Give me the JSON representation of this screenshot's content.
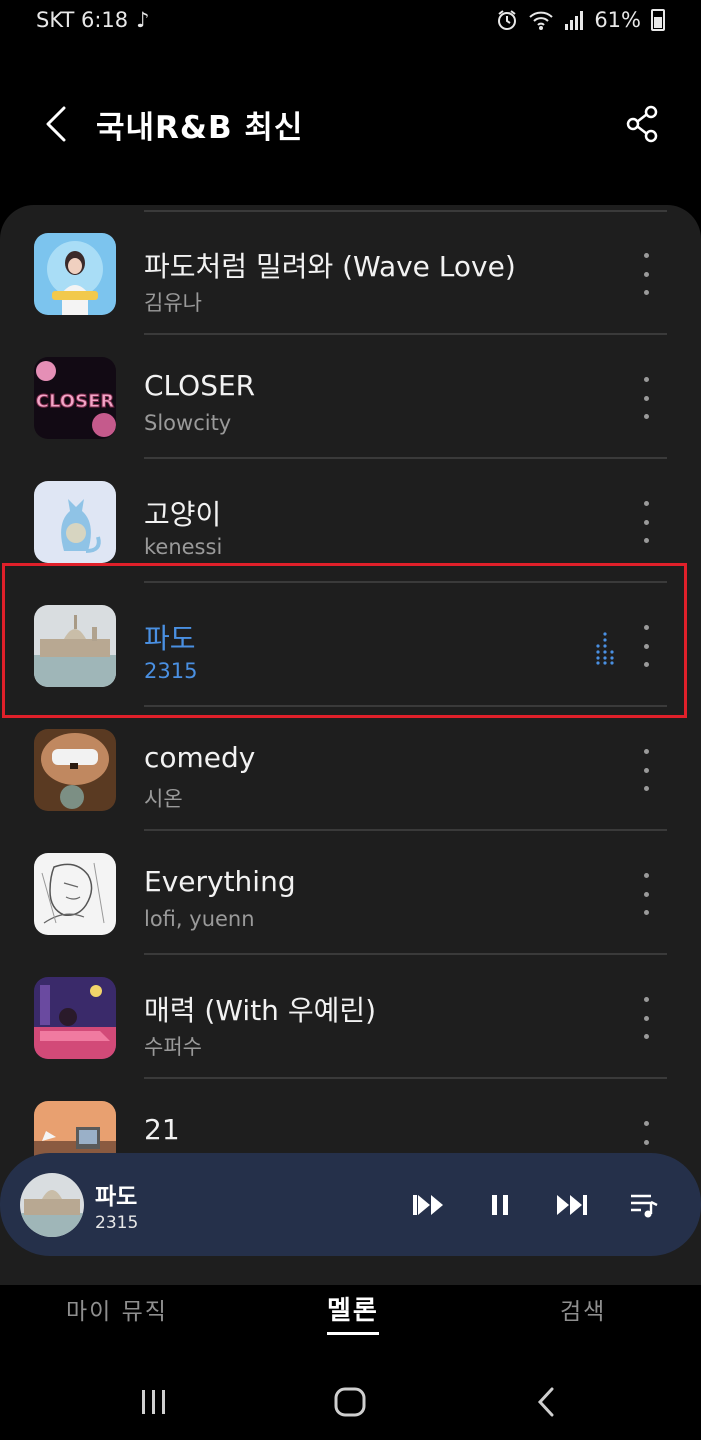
{
  "status_bar": {
    "carrier_time": "SKT 6:18",
    "music_glyph": "♪",
    "battery": "61%"
  },
  "header": {
    "title": "국내R&B 최신",
    "back_icon": "back-chevron-icon",
    "share_icon": "share-icon"
  },
  "tracks": [
    {
      "title": "파도처럼 밀려와 (Wave Love)",
      "artist": "김유나",
      "playing": false
    },
    {
      "title": "CLOSER",
      "artist": "Slowcity",
      "playing": false,
      "art_text": "CLOSER"
    },
    {
      "title": "고양이",
      "artist": "kenessi",
      "playing": false
    },
    {
      "title": "파도",
      "artist": "2315",
      "playing": true
    },
    {
      "title": "comedy",
      "artist": "시온",
      "playing": false
    },
    {
      "title": "Everything",
      "artist": "lofi, yuenn",
      "playing": false
    },
    {
      "title": "매력 (With 우예린)",
      "artist": "수퍼수",
      "playing": false
    },
    {
      "title": "21",
      "artist": "",
      "playing": false
    }
  ],
  "mini_player": {
    "title": "파도",
    "artist": "2315"
  },
  "tabs": [
    {
      "label": "마이 뮤직",
      "active": false
    },
    {
      "label": "멜론",
      "active": true
    },
    {
      "label": "검색",
      "active": false
    }
  ],
  "colors": {
    "accent": "#4a90e2",
    "panel": "#1e1e1e",
    "mini_player": "#25304a",
    "highlight": "#e0202a"
  }
}
